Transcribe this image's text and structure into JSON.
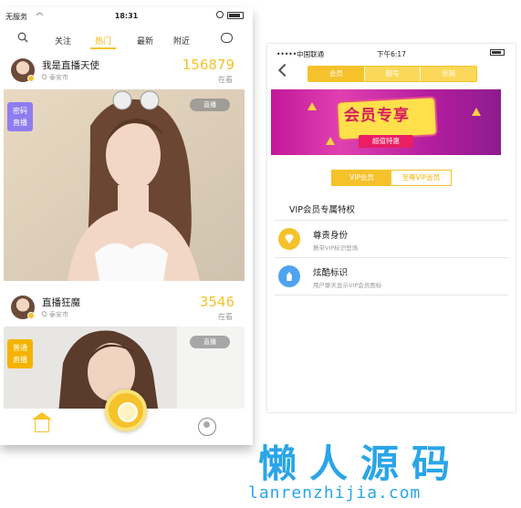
{
  "left_phone": {
    "status": {
      "carrier": "无服务",
      "time": "18:31"
    },
    "tabs": [
      {
        "label": "关注",
        "active": false
      },
      {
        "label": "热门",
        "active": true
      },
      {
        "label": "最新",
        "active": false
      },
      {
        "label": "附近",
        "active": false
      }
    ],
    "streams": [
      {
        "name": "我是直播天使",
        "location": "泰安市",
        "viewer_count": "156879",
        "viewer_label": "在看",
        "live_label": "直播",
        "tag": "密码直播",
        "tag_line1": "密码",
        "tag_line2": "直播"
      },
      {
        "name": "直播狂魔",
        "location": "泰安市",
        "viewer_count": "3546",
        "viewer_label": "在看",
        "live_label": "直播",
        "tag": "普通直播",
        "tag_line1": "普通",
        "tag_line2": "直播"
      }
    ],
    "icons": {
      "search": "search-icon",
      "chat": "chat-icon",
      "home": "home-icon",
      "live": "camera-icon",
      "profile": "user-icon"
    }
  },
  "right_phone": {
    "status": {
      "carrier": "•••••中国联通",
      "time": "下午6:17"
    },
    "nav_tabs": [
      {
        "label": "会员",
        "active": true
      },
      {
        "label": "靓号",
        "active": false
      },
      {
        "label": "坐骑",
        "active": false
      }
    ],
    "banner": {
      "title": "会员专享",
      "subtitle": "超值特惠"
    },
    "vip_options": [
      {
        "label": "VIP会员",
        "active": true
      },
      {
        "label": "至尊VIP会员",
        "active": false
      }
    ],
    "privileges_title": "VIP会员专属特权",
    "privileges": [
      {
        "title": "尊贵身份",
        "desc": "携带VIP标识登场",
        "icon": "gem-icon"
      },
      {
        "title": "炫酷标识",
        "desc": "用户聊天显示VIP会员图标",
        "icon": "rocket-icon"
      }
    ]
  },
  "watermark": {
    "cn": "懒人源码",
    "en": "lanrenzhijia.com"
  },
  "colors": {
    "accent": "#f5c22b",
    "tag_purple": "#8f7cf0",
    "tag_orange": "#f5b300",
    "gem_icon": "#f5c22b",
    "rocket_icon": "#4fa3f0",
    "watermark": "#2aa5e8"
  }
}
